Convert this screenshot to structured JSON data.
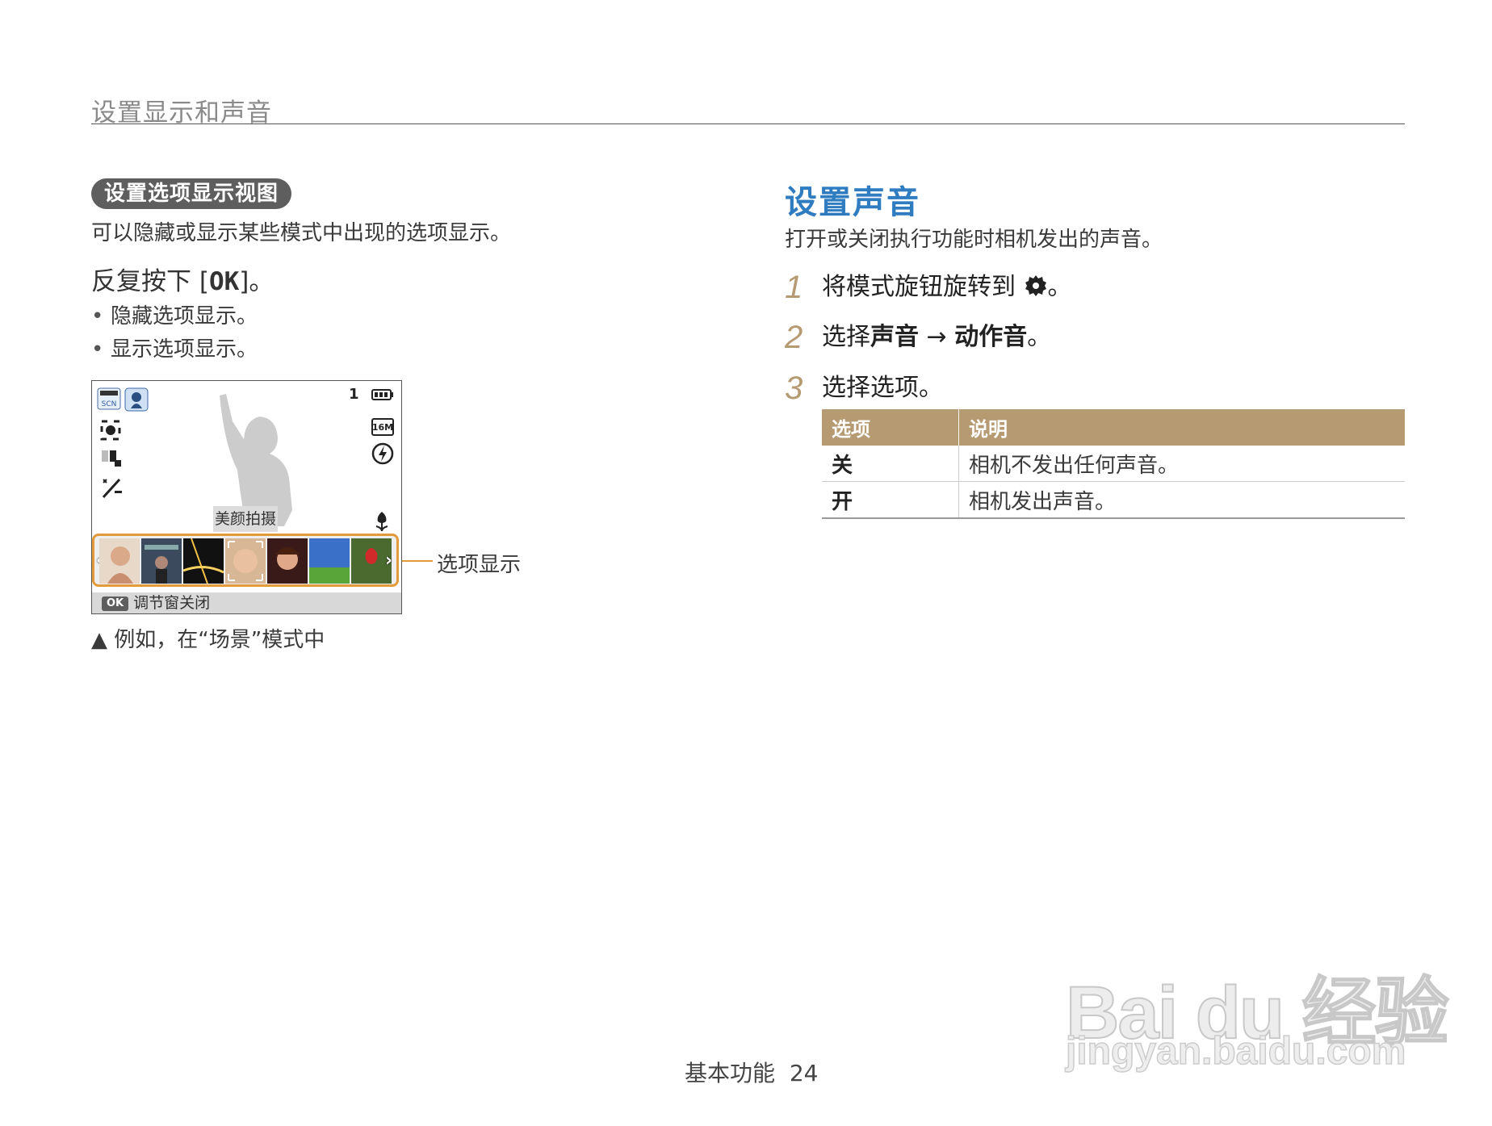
{
  "header": {
    "title": "设置显示和声音"
  },
  "left": {
    "pill_title": "设置选项显示视图",
    "description": "可以隐藏或显示某些模式中出现的选项显示。",
    "step_prefix": "反复按下 [",
    "step_key": "OK",
    "step_suffix": "]。",
    "bullets": [
      "隐藏选项显示。",
      "显示选项显示。"
    ],
    "camera": {
      "top_count": "1",
      "mode_label": "美颜拍摄",
      "scn_label": "SCN",
      "size_label": "16M",
      "ok_key": "OK",
      "bottom_text": "调节窗关闭"
    },
    "callout_label": "选项显示",
    "caption": "▲ 例如，在“场景”模式中"
  },
  "right": {
    "title": "设置声音",
    "description": "打开或关闭执行功能时相机发出的声音。",
    "steps": [
      {
        "num": "1",
        "text_a": "将模式旋钮旋转到 ",
        "icon": "gear-icon",
        "text_b": "。"
      },
      {
        "num": "2",
        "text_a": "选择",
        "bold_a": "声音",
        "arrow": " → ",
        "bold_b": "动作音",
        "text_b": "。"
      },
      {
        "num": "3",
        "text_a": "选择选项。"
      }
    ],
    "table": {
      "headers": [
        "选项",
        "说明"
      ],
      "rows": [
        [
          "关",
          "相机不发出任何声音。"
        ],
        [
          "开",
          "相机发出声音。"
        ]
      ]
    }
  },
  "footer": {
    "section": "基本功能",
    "page": "24"
  },
  "watermark": {
    "main": "Bai du 经验",
    "sub": "jingyan.baidu.com"
  },
  "colors": {
    "accent_blue": "#2f7cc1",
    "table_header": "#b59a72",
    "callout_orange": "#e39a3a",
    "pill_bg": "#5e5e5e"
  }
}
